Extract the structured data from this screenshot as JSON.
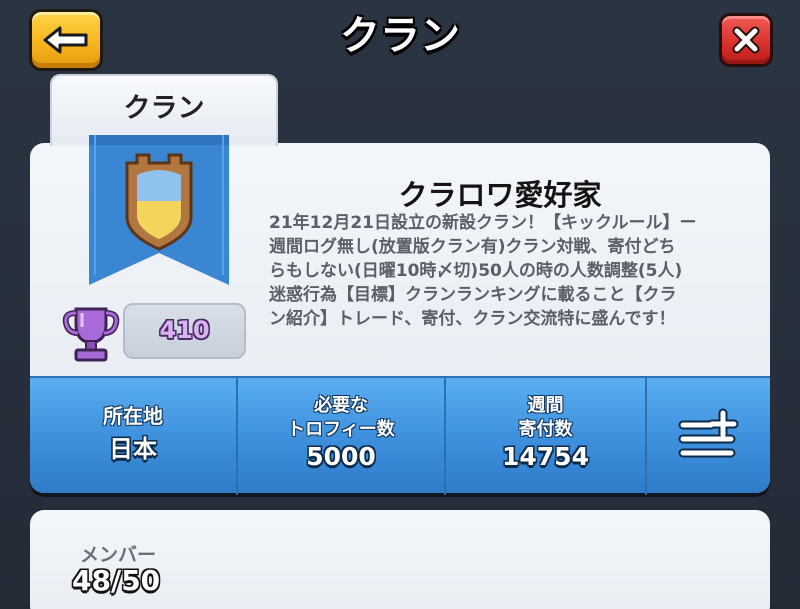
{
  "header": {
    "title": "クラン",
    "back_icon": "arrow-left-icon",
    "close_icon": "close-x-icon"
  },
  "tabs": [
    {
      "label": "クラン",
      "selected": true
    }
  ],
  "clan": {
    "name": "クラロワ愛好家",
    "description_lines": [
      "21年12月21日設立の新設クラン！【キックルール】ー",
      "週間ログ無し(放置版クラン有)クラン対戦、寄付どち",
      "らもしない(日曜10時〆切)50人の時の人数調整(5人)",
      "迷惑行為【目標】クランランキングに載ること【クラ",
      "ン紹介】トレード、寄付、クラン交流特に盛んです！"
    ],
    "badge_icon": "clan-badge-icon",
    "trophy_icon": "trophy-icon",
    "trophies": "410"
  },
  "stats": {
    "location_label": "所在地",
    "location_value": "日本",
    "required_label_1": "必要な",
    "required_label_2": "トロフィー数",
    "required_value": "5000",
    "weekly_label_1": "週間",
    "weekly_label_2": "寄付数",
    "weekly_value": "14754",
    "menu_icon": "menu-plus-icon"
  },
  "members": {
    "label": "メンバー",
    "count": "48/50"
  },
  "colors": {
    "back_button": "#f6b21a",
    "close_button": "#d8302c",
    "stats_bar": "#3d8fdc",
    "banner": "#3b86d3",
    "trophy_purple": "#9b5cc4"
  }
}
